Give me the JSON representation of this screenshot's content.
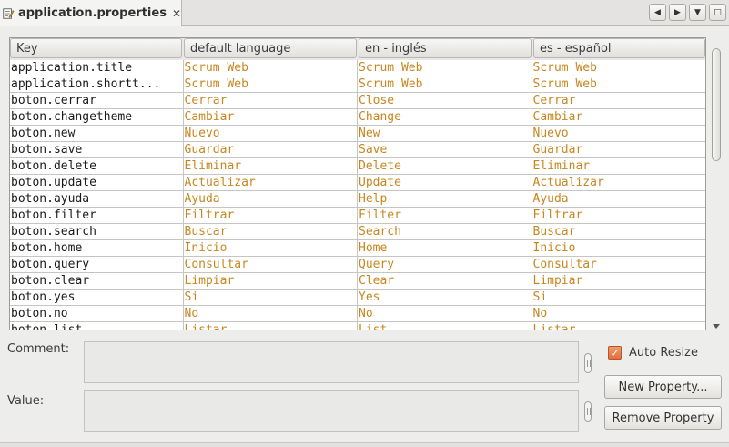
{
  "tab": {
    "title": "application.properties",
    "close_glyph": "✕",
    "icon": "properties-file-icon"
  },
  "nav": {
    "left": "◀",
    "right": "▶",
    "dropdown": "▼",
    "maximize": "□"
  },
  "table": {
    "headers": [
      "Key",
      "default language",
      "en - inglés",
      "es - español"
    ],
    "rows": [
      [
        "application.title",
        "Scrum Web",
        "Scrum Web",
        "Scrum Web"
      ],
      [
        "application.shortt...",
        "Scrum Web",
        "Scrum Web",
        "Scrum Web"
      ],
      [
        "boton.cerrar",
        "Cerrar",
        "Close",
        "Cerrar"
      ],
      [
        "boton.changetheme",
        "Cambiar",
        "Change",
        "Cambiar"
      ],
      [
        "boton.new",
        "Nuevo",
        "New",
        "Nuevo"
      ],
      [
        "boton.save",
        "Guardar",
        "Save",
        "Guardar"
      ],
      [
        "boton.delete",
        "Eliminar",
        "Delete",
        "Eliminar"
      ],
      [
        "boton.update",
        "Actualizar",
        "Update",
        "Actualizar"
      ],
      [
        "boton.ayuda",
        "Ayuda",
        "Help",
        "Ayuda"
      ],
      [
        "boton.filter",
        "Filtrar",
        "Filter",
        "Filtrar"
      ],
      [
        "boton.search",
        "Buscar",
        "Search",
        "Buscar"
      ],
      [
        "boton.home",
        "Inicio",
        "Home",
        "Inicio"
      ],
      [
        "boton.query",
        "Consultar",
        "Query",
        "Consultar"
      ],
      [
        "boton.clear",
        "Limpiar",
        "Clear",
        "Limpiar"
      ],
      [
        "boton.yes",
        "Si",
        "Yes",
        "Si"
      ],
      [
        "boton.no",
        "No",
        "No",
        "No"
      ],
      [
        "boton.list",
        "Listar",
        "List",
        "Listar"
      ]
    ]
  },
  "form": {
    "comment_label": "Comment:",
    "comment_value": "",
    "value_label": "Value:",
    "value_value": "",
    "auto_resize_label": "Auto Resize",
    "auto_resize_checked": true,
    "new_property_label": "New Property...",
    "remove_property_label": "Remove Property"
  },
  "colors": {
    "value_text": "#c8861f",
    "checkbox_accent": "#e0703e"
  }
}
